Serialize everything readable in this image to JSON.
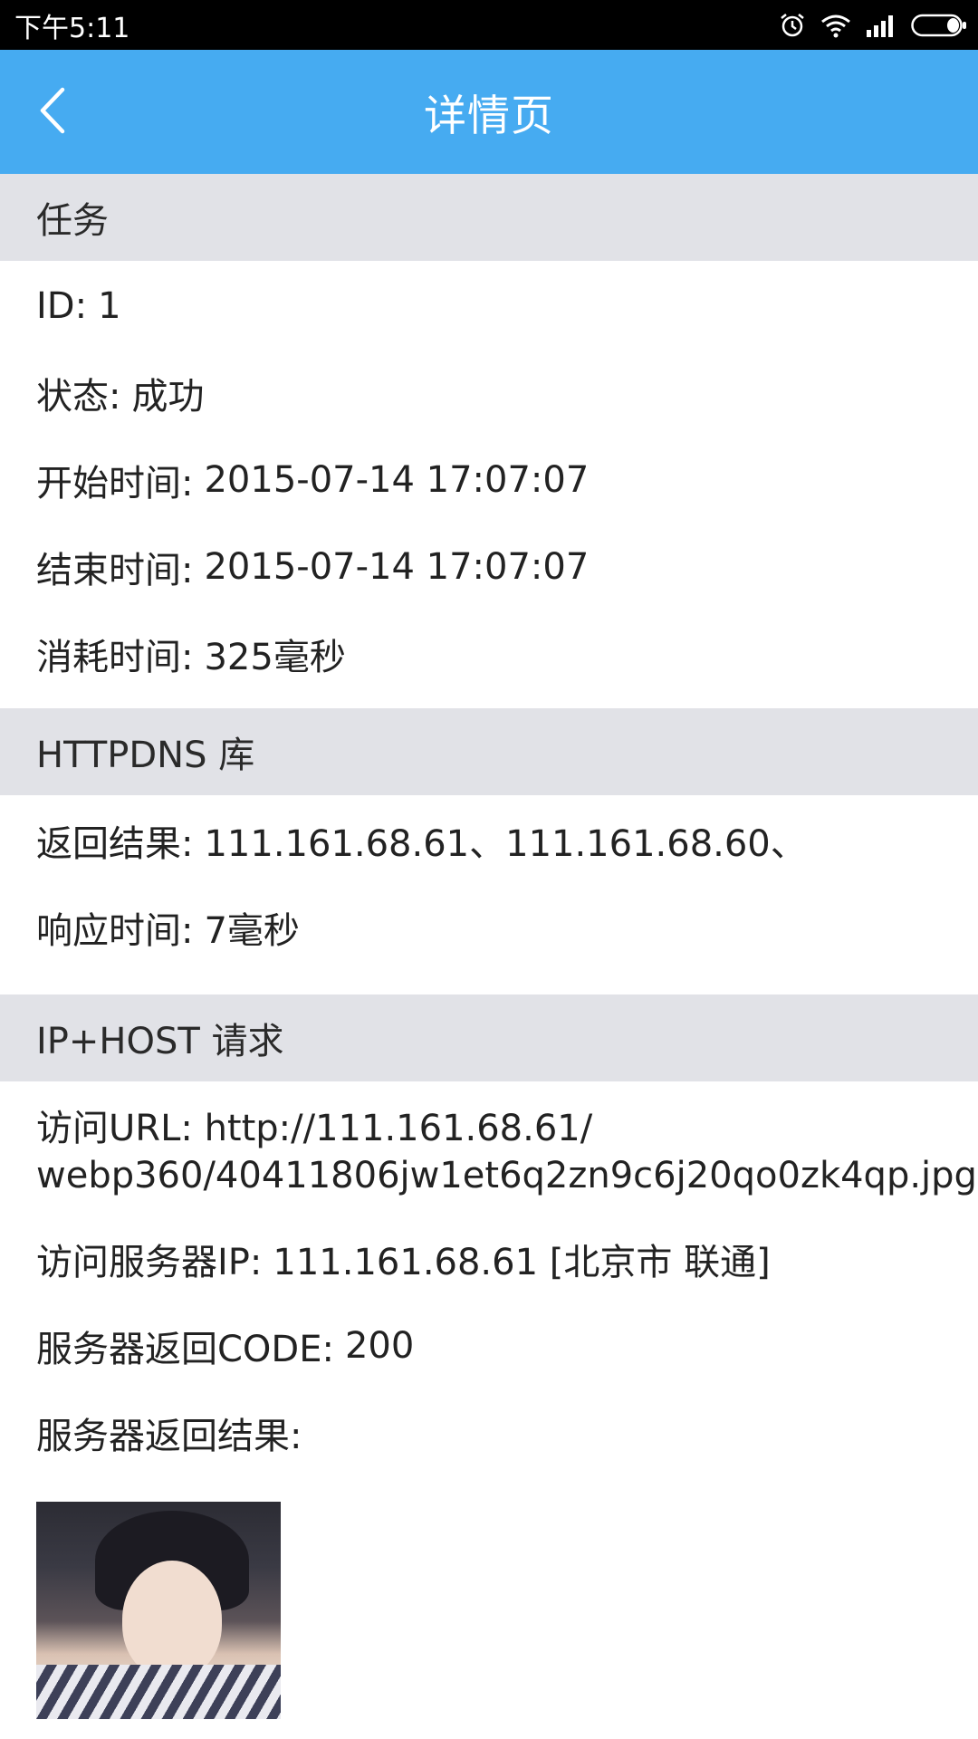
{
  "status_bar": {
    "time": "下午5:11",
    "icons": [
      "alarm-icon",
      "wifi-icon",
      "signal-icon",
      "battery-icon"
    ]
  },
  "header": {
    "title": "详情页",
    "back_icon": "chevron-left-icon",
    "color": "#46abf1"
  },
  "task_section": {
    "title": "任务",
    "id_label": "ID:",
    "id_value": "1",
    "status_label": "状态:",
    "status_value": "成功",
    "start_label": "开始时间:",
    "start_value": "2015-07-14 17:07:07",
    "end_label": "结束时间:",
    "end_value": "2015-07-14 17:07:07",
    "elapsed_label": "消耗时间:",
    "elapsed_value": "325毫秒"
  },
  "httpdns_section": {
    "title": "HTTPDNS 库",
    "result_label": "返回结果:",
    "result_value": "111.161.68.61、111.161.68.60、",
    "response_label": "响应时间:",
    "response_value": "7毫秒"
  },
  "iphost_section": {
    "title": "IP+HOST 请求",
    "url_label": "访问URL:",
    "url_value_line1": "http://111.161.68.61/",
    "url_value_line2": "webp360/40411806jw1et6q2zn9c6j20qo0zk4qp.jpg",
    "server_ip_label": "访问服务器IP:",
    "server_ip_value": "111.161.68.61 [北京市 联通]",
    "code_label": "服务器返回CODE:",
    "code_value": "200",
    "result_label": "服务器返回结果:"
  }
}
